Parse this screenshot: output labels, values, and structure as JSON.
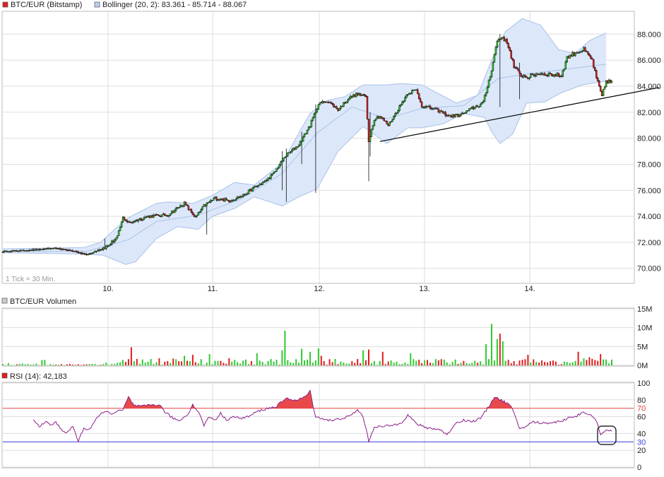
{
  "colors": {
    "up": "#2ecc2e",
    "down": "#e21c1c",
    "candle_outline": "#111111",
    "band_fill": "#dce8fa",
    "band_line": "#a9c1e6",
    "rsi_line": "#8b1e8b",
    "rsi_over": "#e84a4a",
    "line70": "#e04040",
    "line30": "#3b3bdb",
    "grid": "#dddddd",
    "trend": "#000000"
  },
  "legend": {
    "main_series": "BTC/EUR (Bitstamp)",
    "bollinger": "Bollinger (20, 2): 83.361 - 85.714 - 88.067",
    "volume": "BTC/EUR Volumen",
    "rsi": "RSI (14): 42,183"
  },
  "tick_note": "1 Tick = 30 Min.",
  "chart_data": [
    {
      "type": "candlestick",
      "title": "BTC/EUR (Bitstamp)",
      "x_ticks": [
        "10.",
        "11.",
        "12.",
        "13.",
        "14."
      ],
      "ylim": [
        68.9,
        89.7
      ],
      "y_ticks": [
        "70.000",
        "72.000",
        "74.000",
        "76.000",
        "78.000",
        "80.000",
        "82.000",
        "84.000",
        "86.000",
        "88.000"
      ],
      "y_tick_values": [
        70,
        72,
        74,
        76,
        78,
        80,
        82,
        84,
        86,
        88
      ],
      "grid": true,
      "anchors": [
        [
          0,
          71.3
        ],
        [
          20,
          71.4
        ],
        [
          38,
          71.55
        ],
        [
          52,
          71.3
        ],
        [
          60,
          71.05
        ],
        [
          66,
          71.3
        ],
        [
          75,
          71.7
        ],
        [
          82,
          72.4
        ],
        [
          86,
          73.9
        ],
        [
          90,
          73.5
        ],
        [
          104,
          74.0
        ],
        [
          118,
          74.1
        ],
        [
          130,
          75.0
        ],
        [
          138,
          73.9
        ],
        [
          144,
          74.8
        ],
        [
          152,
          75.4
        ],
        [
          162,
          75.2
        ],
        [
          172,
          75.6
        ],
        [
          180,
          76.2
        ],
        [
          188,
          76.7
        ],
        [
          194,
          77.3
        ],
        [
          202,
          78.6
        ],
        [
          212,
          79.5
        ],
        [
          220,
          81.0
        ],
        [
          226,
          82.6
        ],
        [
          232,
          82.9
        ],
        [
          240,
          82.2
        ],
        [
          248,
          83.1
        ],
        [
          254,
          83.4
        ],
        [
          260,
          83.2
        ],
        [
          262,
          79.8
        ],
        [
          266,
          81.5
        ],
        [
          270,
          81.7
        ],
        [
          276,
          81.0
        ],
        [
          284,
          82.4
        ],
        [
          290,
          83.5
        ],
        [
          296,
          83.7
        ],
        [
          300,
          82.5
        ],
        [
          310,
          82.2
        ],
        [
          320,
          81.7
        ],
        [
          328,
          81.8
        ],
        [
          336,
          82.3
        ],
        [
          344,
          82.7
        ],
        [
          350,
          85.3
        ],
        [
          354,
          87.5
        ],
        [
          358,
          87.8
        ],
        [
          362,
          87.1
        ],
        [
          366,
          85.5
        ],
        [
          370,
          84.9
        ],
        [
          376,
          84.7
        ],
        [
          384,
          85.0
        ],
        [
          392,
          84.9
        ],
        [
          400,
          84.8
        ],
        [
          404,
          86.2
        ],
        [
          410,
          86.6
        ],
        [
          416,
          86.8
        ],
        [
          422,
          86.0
        ],
        [
          425,
          84.6
        ],
        [
          429,
          83.2
        ],
        [
          432,
          84.4
        ],
        [
          436,
          84.3
        ]
      ],
      "n_bars": 437,
      "wicks": [
        {
          "bar": 73,
          "low": 71.6,
          "high": 72.3
        },
        {
          "bar": 146,
          "low": 72.6,
          "high": 74.6
        },
        {
          "bar": 200,
          "low": 76.0,
          "high": 79.0
        },
        {
          "bar": 203,
          "low": 75.1,
          "high": 79.2
        },
        {
          "bar": 214,
          "low": 78.0,
          "high": 80.5
        },
        {
          "bar": 224,
          "low": 75.8,
          "high": 82.6
        },
        {
          "bar": 262,
          "low": 76.7,
          "high": 81.5
        },
        {
          "bar": 263,
          "low": 78.6,
          "high": 82.0
        },
        {
          "bar": 356,
          "low": 82.4,
          "high": 88.0
        },
        {
          "bar": 370,
          "low": 83.0,
          "high": 85.8
        }
      ],
      "bollinger": {
        "center": [
          [
            0,
            71.3
          ],
          [
            60,
            71.3
          ],
          [
            90,
            72.2
          ],
          [
            110,
            73.6
          ],
          [
            140,
            74.1
          ],
          [
            170,
            75.3
          ],
          [
            200,
            77.3
          ],
          [
            225,
            80.4
          ],
          [
            250,
            82.4
          ],
          [
            275,
            81.5
          ],
          [
            300,
            82.3
          ],
          [
            330,
            82.5
          ],
          [
            355,
            84.6
          ],
          [
            380,
            85.0
          ],
          [
            410,
            85.4
          ],
          [
            432,
            85.7
          ]
        ],
        "upper": [
          [
            0,
            71.5
          ],
          [
            58,
            71.6
          ],
          [
            70,
            72.0
          ],
          [
            80,
            73.0
          ],
          [
            90,
            73.9
          ],
          [
            110,
            75.0
          ],
          [
            118,
            75.1
          ],
          [
            136,
            75.0
          ],
          [
            150,
            75.6
          ],
          [
            166,
            76.6
          ],
          [
            180,
            76.4
          ],
          [
            200,
            78.1
          ],
          [
            212,
            80.4
          ],
          [
            220,
            81.9
          ],
          [
            232,
            82.9
          ],
          [
            245,
            83.2
          ],
          [
            258,
            84.1
          ],
          [
            275,
            84.1
          ],
          [
            285,
            84.2
          ],
          [
            300,
            84.1
          ],
          [
            325,
            82.7
          ],
          [
            340,
            83.3
          ],
          [
            350,
            86.0
          ],
          [
            360,
            88.2
          ],
          [
            372,
            89.2
          ],
          [
            385,
            88.7
          ],
          [
            398,
            86.8
          ],
          [
            410,
            86.5
          ],
          [
            420,
            87.5
          ],
          [
            432,
            88.1
          ]
        ],
        "lower": [
          [
            0,
            71.2
          ],
          [
            58,
            71.1
          ],
          [
            72,
            71.0
          ],
          [
            88,
            70.3
          ],
          [
            95,
            70.5
          ],
          [
            110,
            72.3
          ],
          [
            125,
            73.2
          ],
          [
            140,
            73.0
          ],
          [
            150,
            74.0
          ],
          [
            166,
            74.6
          ],
          [
            180,
            75.5
          ],
          [
            200,
            74.8
          ],
          [
            212,
            75.5
          ],
          [
            225,
            76.1
          ],
          [
            240,
            79.0
          ],
          [
            258,
            80.9
          ],
          [
            275,
            79.6
          ],
          [
            290,
            80.8
          ],
          [
            300,
            80.8
          ],
          [
            315,
            81.1
          ],
          [
            330,
            81.9
          ],
          [
            345,
            81.6
          ],
          [
            350,
            80.5
          ],
          [
            356,
            79.6
          ],
          [
            365,
            80.3
          ],
          [
            375,
            82.7
          ],
          [
            388,
            82.8
          ],
          [
            400,
            83.5
          ],
          [
            415,
            84.1
          ],
          [
            432,
            84.4
          ]
        ]
      },
      "trendline": [
        [
          270,
          79.75
        ],
        [
          470,
          83.9
        ]
      ]
    },
    {
      "type": "bar",
      "title": "BTC/EUR Volumen",
      "ylim": [
        0,
        15
      ],
      "y_ticks": [
        "15M",
        "10M",
        "5M",
        "0M"
      ],
      "y_tick_values": [
        15,
        10,
        5,
        0
      ],
      "unit": "M",
      "spikes": [
        {
          "bar": 92,
          "value": 4.8
        },
        {
          "bar": 136,
          "value": 2.8
        },
        {
          "bar": 148,
          "value": 3.0
        },
        {
          "bar": 182,
          "value": 3.2
        },
        {
          "bar": 200,
          "value": 4.0
        },
        {
          "bar": 202,
          "value": 9.2
        },
        {
          "bar": 214,
          "value": 4.4
        },
        {
          "bar": 220,
          "value": 3.6
        },
        {
          "bar": 226,
          "value": 4.5
        },
        {
          "bar": 258,
          "value": 4.0
        },
        {
          "bar": 262,
          "value": 4.2
        },
        {
          "bar": 272,
          "value": 3.6
        },
        {
          "bar": 292,
          "value": 3.2
        },
        {
          "bar": 346,
          "value": 5.6
        },
        {
          "bar": 350,
          "value": 11.0
        },
        {
          "bar": 354,
          "value": 7.0
        },
        {
          "bar": 356,
          "value": 8.4
        },
        {
          "bar": 358,
          "value": 6.4
        },
        {
          "bar": 376,
          "value": 2.8
        },
        {
          "bar": 412,
          "value": 3.6
        },
        {
          "bar": 428,
          "value": 3.0
        }
      ]
    },
    {
      "type": "line",
      "title": "RSI (14): 42,183",
      "ylim": [
        0,
        100
      ],
      "y_ticks": [
        "100",
        "80",
        "60",
        "40",
        "20",
        "0"
      ],
      "y_tick_values": [
        100,
        80,
        60,
        40,
        20,
        0
      ],
      "overbought": 70,
      "oversold": 30,
      "overbought_label": "70",
      "oversold_label": "30",
      "start_bar": 22,
      "anchors": [
        [
          22,
          56
        ],
        [
          26,
          48
        ],
        [
          30,
          54
        ],
        [
          34,
          50
        ],
        [
          38,
          53
        ],
        [
          42,
          45
        ],
        [
          46,
          40
        ],
        [
          50,
          49
        ],
        [
          54,
          31
        ],
        [
          58,
          46
        ],
        [
          62,
          45
        ],
        [
          66,
          55
        ],
        [
          72,
          66
        ],
        [
          78,
          64
        ],
        [
          86,
          68
        ],
        [
          90,
          83
        ],
        [
          94,
          73
        ],
        [
          100,
          72
        ],
        [
          106,
          74
        ],
        [
          112,
          74
        ],
        [
          116,
          66
        ],
        [
          120,
          60
        ],
        [
          126,
          55
        ],
        [
          132,
          62
        ],
        [
          136,
          74
        ],
        [
          140,
          66
        ],
        [
          144,
          50
        ],
        [
          148,
          60
        ],
        [
          152,
          56
        ],
        [
          156,
          64
        ],
        [
          160,
          56
        ],
        [
          164,
          60
        ],
        [
          170,
          58
        ],
        [
          176,
          60
        ],
        [
          182,
          66
        ],
        [
          190,
          70
        ],
        [
          196,
          72
        ],
        [
          200,
          78
        ],
        [
          204,
          82
        ],
        [
          210,
          79
        ],
        [
          216,
          83
        ],
        [
          220,
          90
        ],
        [
          224,
          60
        ],
        [
          228,
          58
        ],
        [
          236,
          55
        ],
        [
          242,
          58
        ],
        [
          248,
          60
        ],
        [
          254,
          68
        ],
        [
          258,
          60
        ],
        [
          262,
          31
        ],
        [
          266,
          48
        ],
        [
          272,
          48
        ],
        [
          280,
          50
        ],
        [
          286,
          54
        ],
        [
          290,
          62
        ],
        [
          296,
          52
        ],
        [
          302,
          47
        ],
        [
          308,
          46
        ],
        [
          314,
          44
        ],
        [
          318,
          38
        ],
        [
          324,
          52
        ],
        [
          330,
          56
        ],
        [
          336,
          54
        ],
        [
          342,
          58
        ],
        [
          348,
          72
        ],
        [
          352,
          84
        ],
        [
          356,
          80
        ],
        [
          360,
          77
        ],
        [
          364,
          72
        ],
        [
          370,
          46
        ],
        [
          374,
          48
        ],
        [
          380,
          54
        ],
        [
          386,
          52
        ],
        [
          392,
          53
        ],
        [
          398,
          54
        ],
        [
          402,
          56
        ],
        [
          406,
          60
        ],
        [
          410,
          60
        ],
        [
          416,
          66
        ],
        [
          422,
          60
        ],
        [
          426,
          52
        ],
        [
          428,
          38
        ],
        [
          432,
          45
        ],
        [
          436,
          42
        ]
      ]
    }
  ]
}
